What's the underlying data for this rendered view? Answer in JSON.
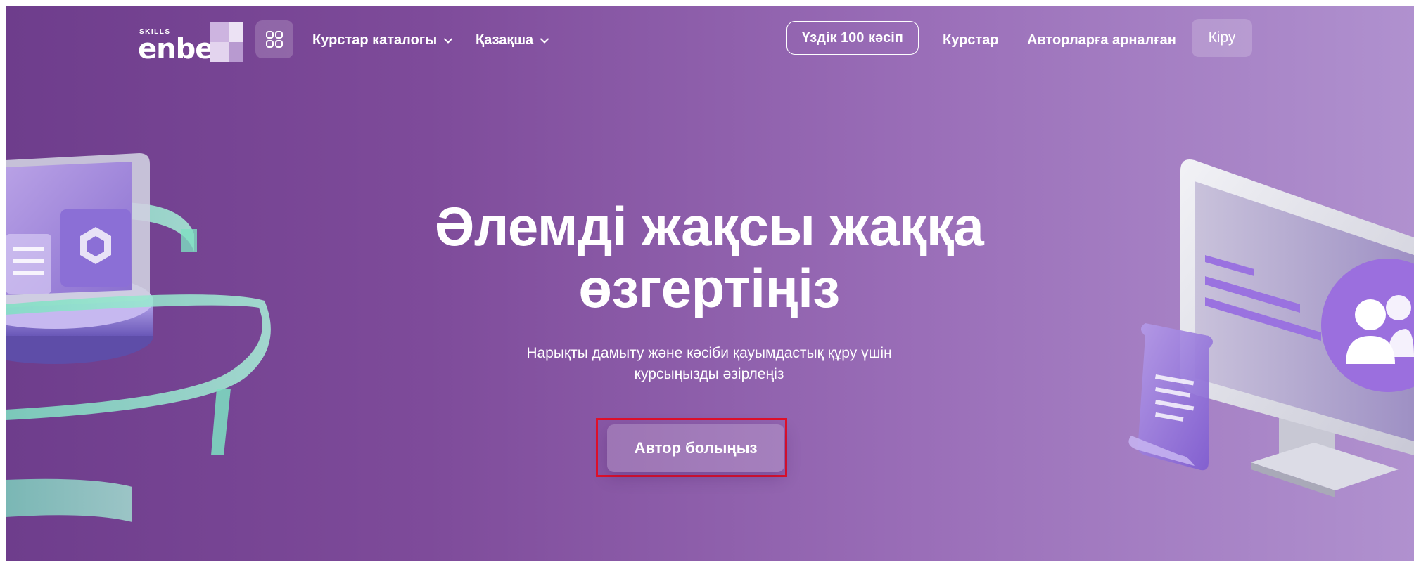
{
  "header": {
    "logo_small": "SKILLS",
    "logo_main": "enbek",
    "apps_icon": "grid-icon",
    "catalog_label": "Курстар каталогы",
    "language_label": "Қазақша",
    "top100_label": "Үздік 100 кәсіп",
    "courses_label": "Курстар",
    "authors_label": "Авторларға арналған",
    "login_label": "Кіру"
  },
  "hero": {
    "title_line1": "Әлемді жақсы жаққа",
    "title_line2": "өзгертіңіз",
    "subtitle_line1": "Нарықты дамыту және кәсіби қауымдастық құру үшін",
    "subtitle_line2": "курсыңызды әзірлеңіз",
    "cta_label": "Автор болыңыз"
  },
  "colors": {
    "gradient_start": "#6e3d8c",
    "gradient_end": "#b091cf",
    "highlight_outline": "#e0102a"
  }
}
